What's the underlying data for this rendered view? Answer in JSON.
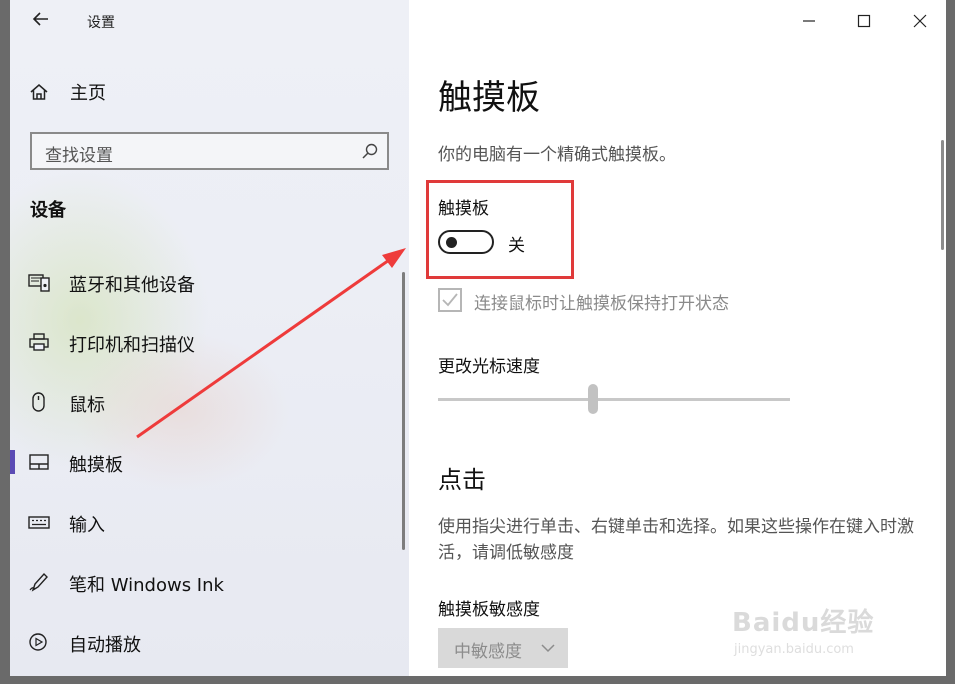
{
  "window": {
    "title": "设置",
    "controls": {
      "minimize": "minimize",
      "maximize": "maximize",
      "close": "close"
    }
  },
  "sidebar": {
    "home_label": "主页",
    "search_placeholder": "查找设置",
    "section_title": "设备",
    "items": [
      {
        "label": "蓝牙和其他设备",
        "icon": "bluetooth-devices-icon"
      },
      {
        "label": "打印机和扫描仪",
        "icon": "printer-icon"
      },
      {
        "label": "鼠标",
        "icon": "mouse-icon"
      },
      {
        "label": "触摸板",
        "icon": "touchpad-icon",
        "active": true
      },
      {
        "label": "输入",
        "icon": "keyboard-icon"
      },
      {
        "label": "笔和 Windows Ink",
        "icon": "pen-icon"
      },
      {
        "label": "自动播放",
        "icon": "autoplay-icon"
      }
    ]
  },
  "main": {
    "title": "触摸板",
    "description": "你的电脑有一个精确式触摸板。",
    "touchpad_toggle": {
      "label": "触摸板",
      "state": "关",
      "on": false
    },
    "mouse_keep_on": {
      "label": "连接鼠标时让触摸板保持打开状态",
      "checked": true,
      "disabled": true
    },
    "cursor_speed": {
      "label": "更改光标速度",
      "value": 0.44
    },
    "tap_section": {
      "title": "点击",
      "description": "使用指尖进行单击、右键单击和选择。如果这些操作在键入时激活，请调低敏感度"
    },
    "sensitivity": {
      "label": "触摸板敏感度",
      "selected": "中敏感度"
    }
  },
  "watermark": {
    "text": "Baidu经验",
    "url": "jingyan.baidu.com"
  },
  "colors": {
    "accent": "#5b4bb4",
    "highlight": "#e03a3a",
    "arrow": "#ee3b3b"
  }
}
